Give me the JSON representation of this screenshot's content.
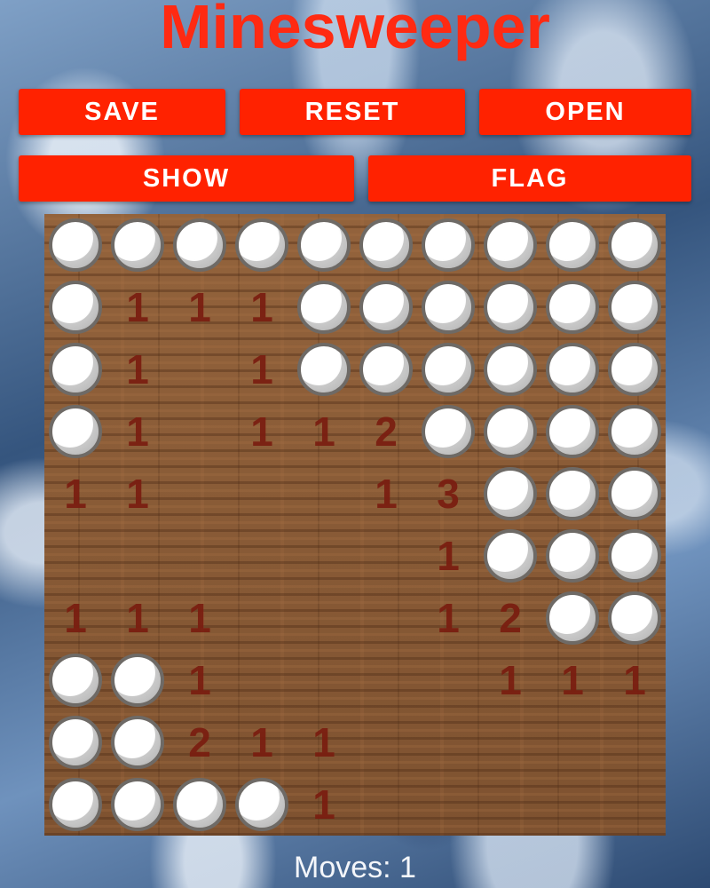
{
  "app": {
    "title": "Minesweeper"
  },
  "buttons": {
    "save": "SAVE",
    "reset": "RESET",
    "open": "OPEN",
    "show": "SHOW",
    "flag": "FLAG"
  },
  "board": {
    "rows": 10,
    "cols": 10,
    "cells": [
      [
        "C",
        "C",
        "C",
        "C",
        "C",
        "C",
        "C",
        "C",
        "C",
        "C"
      ],
      [
        "C",
        "1",
        "1",
        "1",
        "C",
        "C",
        "C",
        "C",
        "C",
        "C"
      ],
      [
        "C",
        "1",
        "",
        "1",
        "C",
        "C",
        "C",
        "C",
        "C",
        "C"
      ],
      [
        "C",
        "1",
        "",
        "1",
        "1",
        "2",
        "C",
        "C",
        "C",
        "C"
      ],
      [
        "1",
        "1",
        "",
        "",
        "",
        "1",
        "3",
        "C",
        "C",
        "C"
      ],
      [
        "",
        "",
        "",
        "",
        "",
        "",
        "1",
        "C",
        "C",
        "C"
      ],
      [
        "1",
        "1",
        "1",
        "",
        "",
        "",
        "1",
        "2",
        "C",
        "C"
      ],
      [
        "C",
        "C",
        "1",
        "",
        "",
        "",
        "",
        "1",
        "1",
        "1"
      ],
      [
        "C",
        "C",
        "2",
        "1",
        "1",
        "",
        "",
        "",
        "",
        ""
      ],
      [
        "C",
        "C",
        "C",
        "C",
        "1",
        "",
        "",
        "",
        "",
        ""
      ]
    ]
  },
  "status": {
    "moves_label": "Moves: 1"
  },
  "colors": {
    "title": "#ff2a12",
    "button_bg": "#ff2200",
    "button_text": "#ffffff",
    "number": "#7a1d10"
  }
}
